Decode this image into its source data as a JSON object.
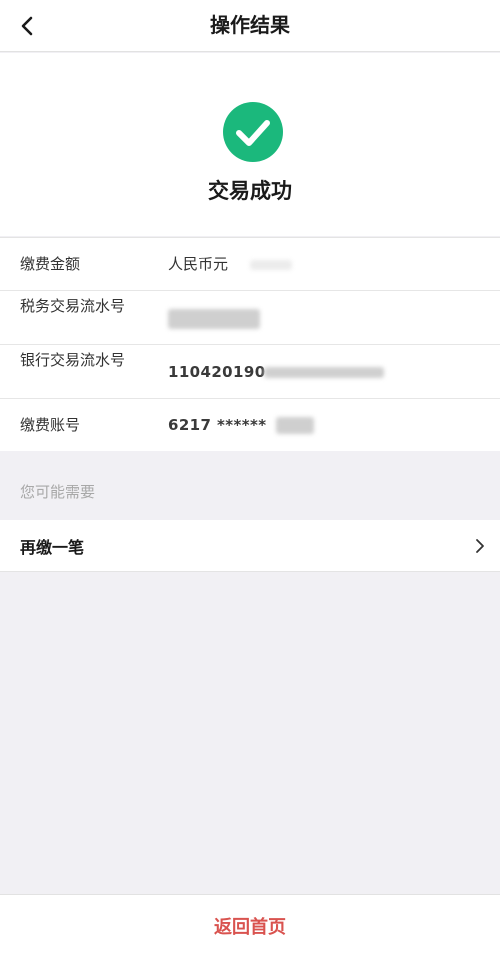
{
  "header": {
    "back_icon": "chevron-left-icon",
    "title": "操作结果"
  },
  "result": {
    "icon": "check-circle-icon",
    "icon_color": "#1bb87c",
    "status": "交易成功"
  },
  "details": [
    {
      "label": "缴费金额",
      "value": "人民币元"
    },
    {
      "label": "税务交易流水号",
      "value": ""
    },
    {
      "label": "银行交易流水号",
      "value": "110420190"
    },
    {
      "label": "缴费账号",
      "value": "6217 ******"
    }
  ],
  "suggestions": {
    "heading": "您可能需要",
    "items": [
      {
        "label": "再缴一笔",
        "icon": "chevron-right-icon"
      }
    ]
  },
  "footer": {
    "home_label": "返回首页",
    "accent_color": "#d9534f"
  }
}
